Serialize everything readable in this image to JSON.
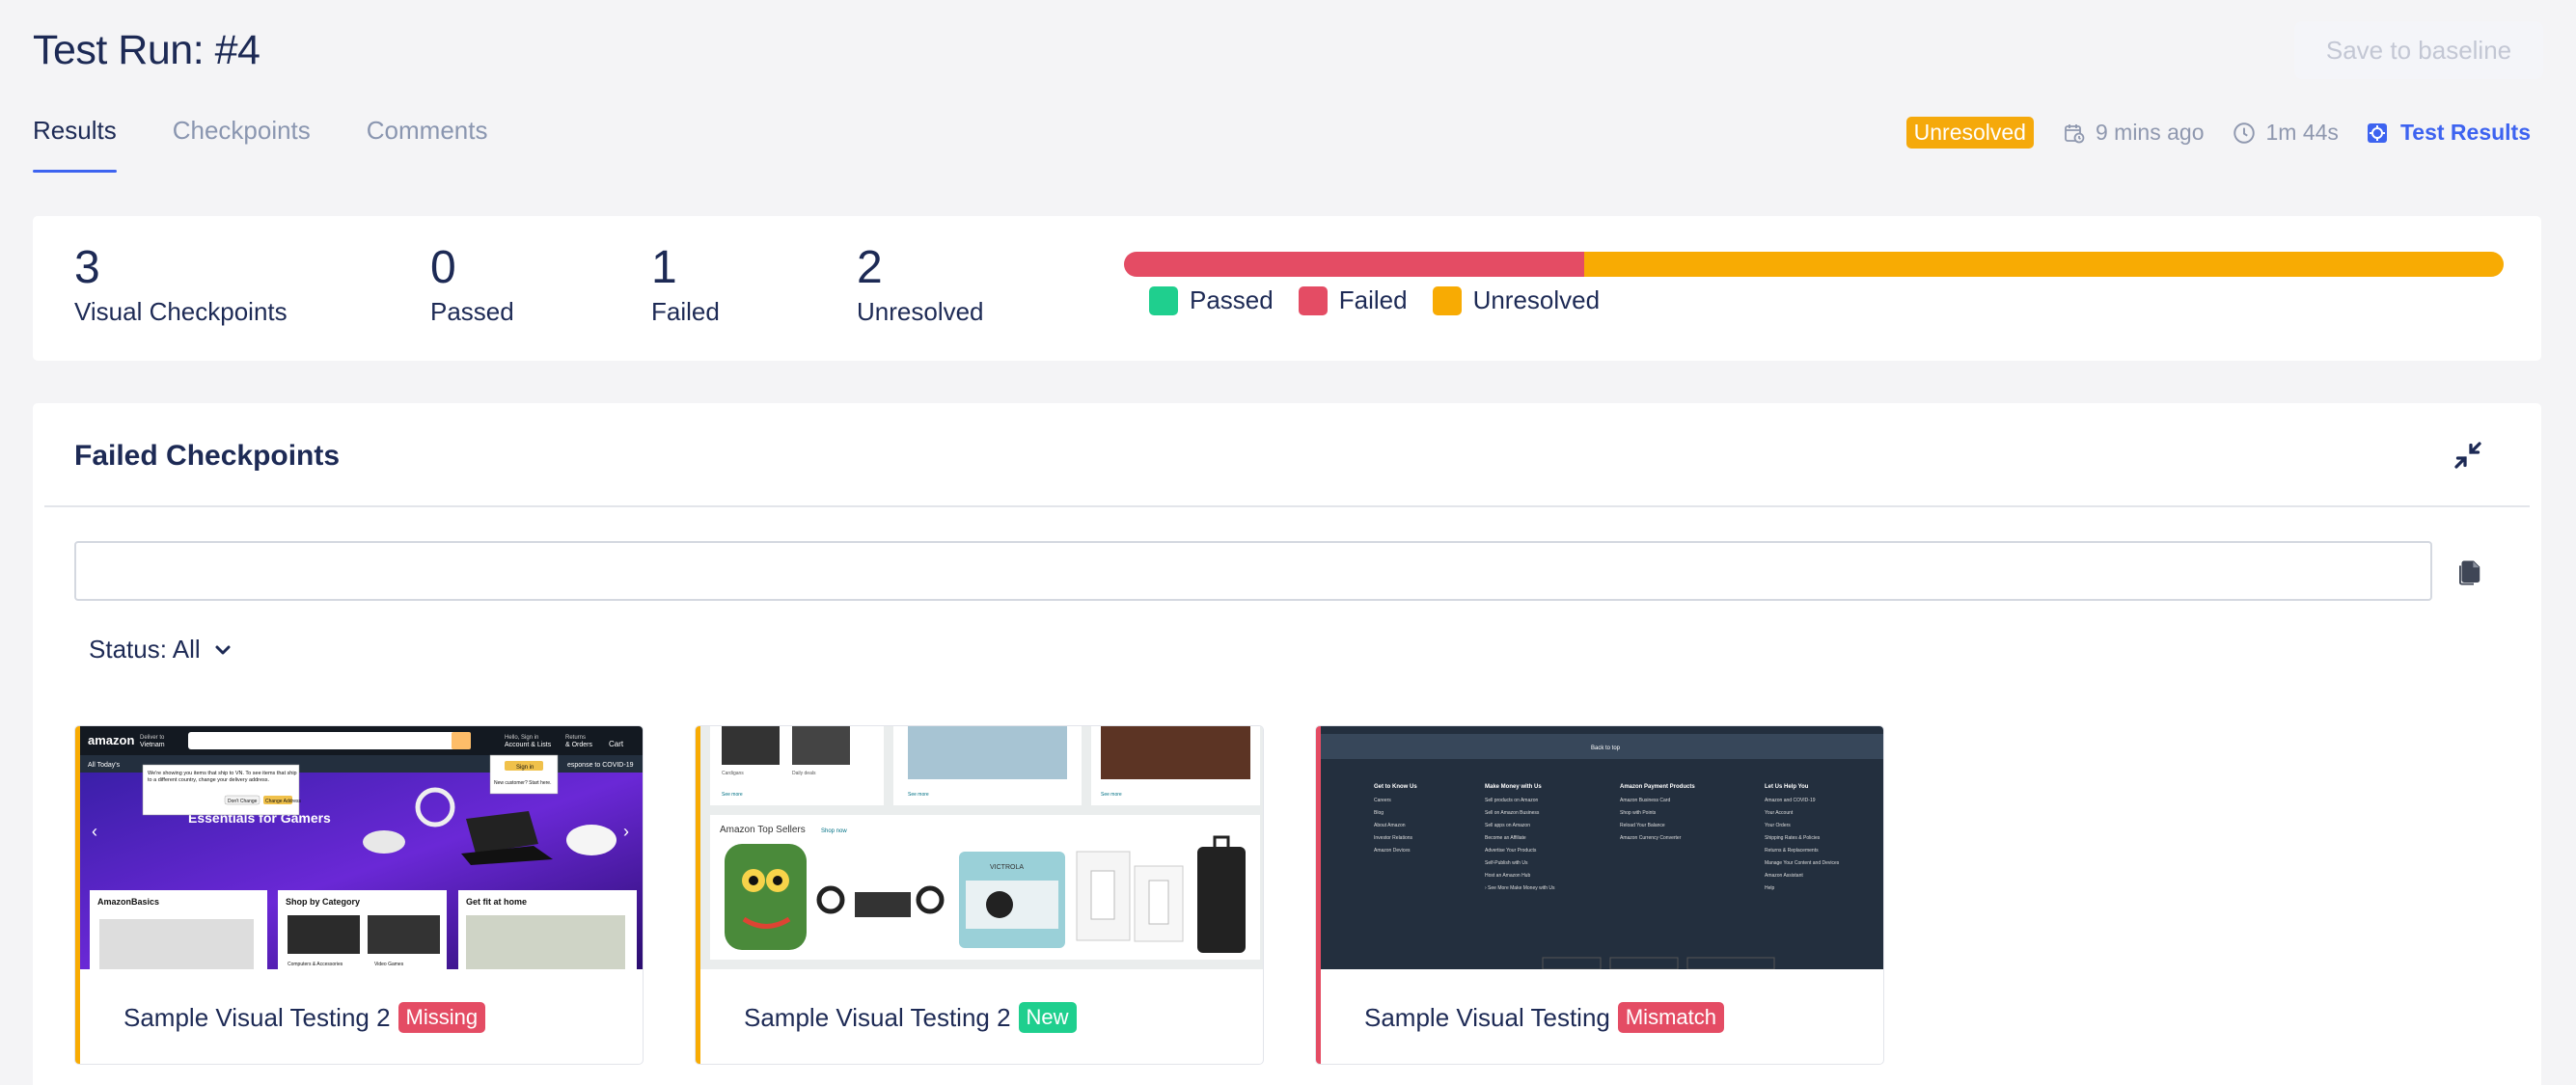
{
  "header": {
    "title": "Test Run: #4",
    "save_label": "Save to baseline"
  },
  "tabs": [
    {
      "label": "Results",
      "active": true
    },
    {
      "label": "Checkpoints",
      "active": false
    },
    {
      "label": "Comments",
      "active": false
    }
  ],
  "meta": {
    "status": "Unresolved",
    "time_ago": "9 mins ago",
    "duration": "1m 44s",
    "results_link": "Test Results"
  },
  "summary": {
    "stats": [
      {
        "value": "3",
        "label": "Visual Checkpoints"
      },
      {
        "value": "0",
        "label": "Passed"
      },
      {
        "value": "1",
        "label": "Failed"
      },
      {
        "value": "2",
        "label": "Unresolved"
      }
    ],
    "progress": {
      "passed": 0,
      "failed": 1,
      "unresolved": 2
    },
    "legend": [
      {
        "label": "Passed",
        "color": "#1fcf8e"
      },
      {
        "label": "Failed",
        "color": "#e44c64"
      },
      {
        "label": "Unresolved",
        "color": "#f8ab03"
      }
    ]
  },
  "failed_panel": {
    "title": "Failed Checkpoints",
    "search_value": "",
    "status_filter": "Status: All"
  },
  "cards": [
    {
      "name": "Sample Visual Testing 2",
      "tag": "Missing",
      "tag_color": "#e44c64",
      "stripe_color": "#f8ab03"
    },
    {
      "name": "Sample Visual Testing 2",
      "tag": "New",
      "tag_color": "#1fcf8e",
      "stripe_color": "#f8ab03"
    },
    {
      "name": "Sample Visual Testing",
      "tag": "Mismatch",
      "tag_color": "#e44c64",
      "stripe_color": "#e44c64"
    }
  ],
  "thumbnails": {
    "amazon_home": {
      "logo": "amazon",
      "deliver_to": "Deliver to\nVietnam",
      "hello": "Hello, Sign in\nAccount & Lists",
      "returns": "Returns\n& Orders",
      "cart": "Cart",
      "nav_all": "All",
      "nav_today": "Today's",
      "popup_text": "We're showing you items that ship to VN. To see items that ship to a different country, change your delivery address.",
      "popup_dont": "Don't Change",
      "popup_change": "Change Address",
      "signin_btn": "Sign in",
      "signin_new": "New customer? Start here.",
      "covid": "esponse to COVID-19",
      "hero": "Essentials for Gamers",
      "box1": "AmazonBasics",
      "box2": "Shop by Category",
      "box3": "Get fit at home",
      "box2_sub1": "Computers & Accessories",
      "box2_sub2": "Video Games"
    },
    "amazon_sellers": {
      "row_labels": [
        "Cardigans",
        "Daily deals"
      ],
      "see_more": "See more",
      "top_sellers": "Amazon Top Sellers",
      "shop_now": "Shop now",
      "victrola": "VICTROLA"
    },
    "amazon_footer": {
      "back_to_top": "Back to top",
      "cols": [
        {
          "title": "Get to Know Us",
          "items": [
            "Careers",
            "Blog",
            "About Amazon",
            "Investor Relations",
            "Amazon Devices"
          ]
        },
        {
          "title": "Make Money with Us",
          "items": [
            "Sell products on Amazon",
            "Sell on Amazon Business",
            "Sell apps on Amazon",
            "Become an Affiliate",
            "Advertise Your Products",
            "Self-Publish with Us",
            "Host an Amazon Hub",
            "› See More Make Money with Us"
          ]
        },
        {
          "title": "Amazon Payment Products",
          "items": [
            "Amazon Business Card",
            "Shop with Points",
            "Reload Your Balance",
            "Amazon Currency Converter"
          ]
        },
        {
          "title": "Let Us Help You",
          "items": [
            "Amazon and COVID-19",
            "Your Account",
            "Your Orders",
            "Shipping Rates & Policies",
            "Returns & Replacements",
            "Manage Your Content and Devices",
            "Amazon Assistant",
            "Help"
          ]
        }
      ]
    }
  }
}
